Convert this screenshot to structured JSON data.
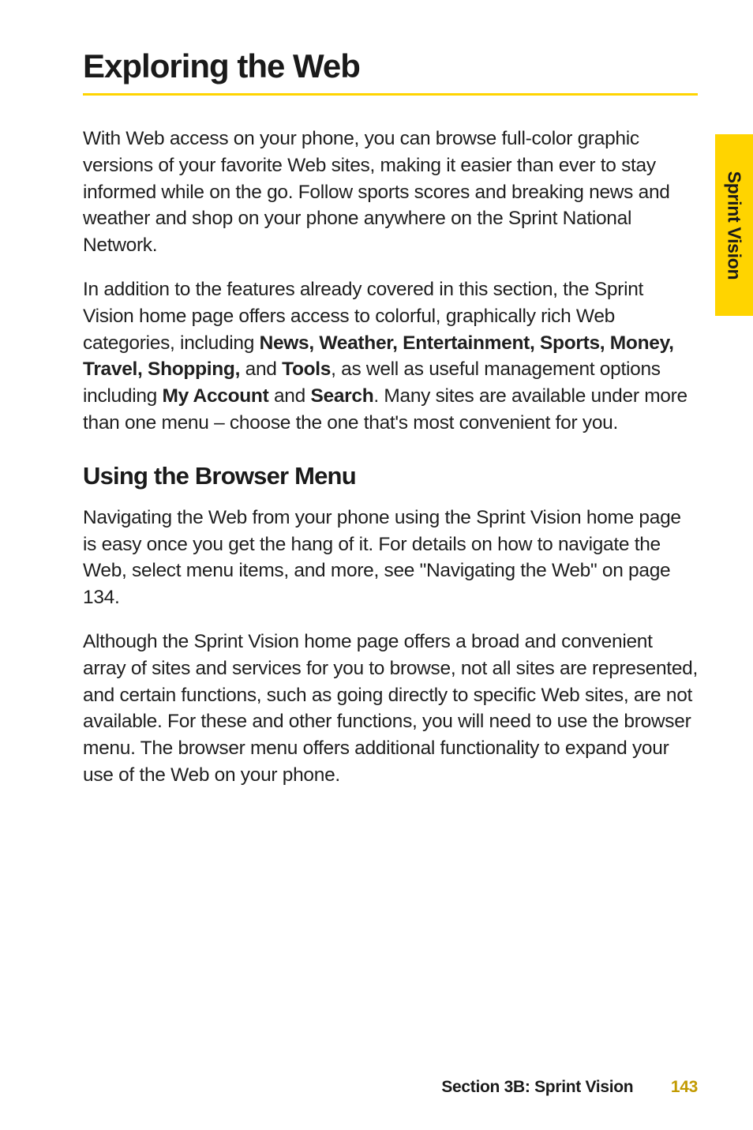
{
  "sideTab": "Sprint Vision",
  "title": "Exploring the Web",
  "paragraphs": {
    "p1": "With Web access on your phone, you can browse full-color graphic versions of your favorite Web sites, making it easier than ever to stay informed while on the go. Follow sports scores and breaking news and weather and shop on your phone anywhere on the Sprint National Network.",
    "p2_a": "In addition to the features already covered in this section, the Sprint Vision home page offers access to colorful, graphically rich Web categories, including ",
    "p2_bold1": "News, Weather, Entertainment, Sports, Money, Travel, Shopping,",
    "p2_b": " and ",
    "p2_bold2": "Tools",
    "p2_c": ", as well as useful management options including ",
    "p2_bold3": "My Account",
    "p2_d": " and ",
    "p2_bold4": "Search",
    "p2_e": ". Many sites are available under more than one menu – choose the one that's most convenient for you."
  },
  "subhead": "Using the Browser Menu",
  "subparagraphs": {
    "s1": "Navigating the Web from your phone using the Sprint Vision home page is easy once you get the hang of it. For details on how to navigate the Web, select menu items, and more, see \"Navigating the Web\" on page 134.",
    "s2": "Although the Sprint Vision home page offers a broad and convenient array of sites and services for you to browse, not all sites are represented, and certain functions, such as going directly to specific Web sites, are not available. For these and other functions, you will need to use the browser menu. The browser menu offers additional functionality to expand your use of the Web on your phone."
  },
  "footer": {
    "section": "Section 3B: Sprint Vision",
    "page": "143"
  }
}
